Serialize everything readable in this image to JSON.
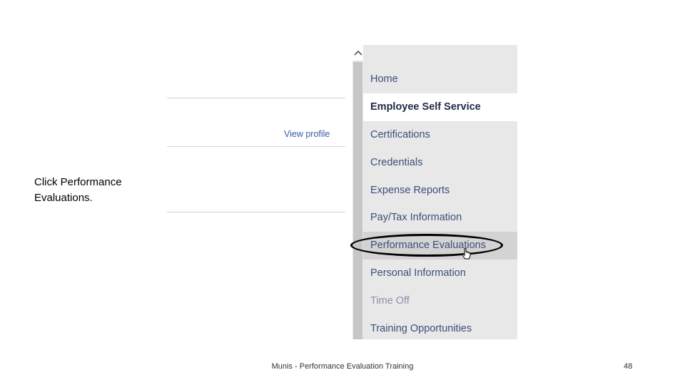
{
  "instruction": "Click Performance Evaluations.",
  "profile": {
    "view_profile_label": "View profile"
  },
  "nav": {
    "items": [
      {
        "label": "Home",
        "state": "normal"
      },
      {
        "label": "Employee Self Service",
        "state": "active"
      },
      {
        "label": "Certifications",
        "state": "normal"
      },
      {
        "label": "Credentials",
        "state": "normal"
      },
      {
        "label": "Expense Reports",
        "state": "normal"
      },
      {
        "label": "Pay/Tax Information",
        "state": "normal"
      },
      {
        "label": "Performance Evaluations",
        "state": "hover-highlighted"
      },
      {
        "label": "Personal Information",
        "state": "normal"
      },
      {
        "label": "Time Off",
        "state": "faded"
      },
      {
        "label": "Training Opportunities",
        "state": "normal"
      }
    ]
  },
  "footer": {
    "caption": "Munis - Performance Evaluation Training",
    "page_number": "48"
  },
  "colors": {
    "nav_background": "#e8e8e8",
    "nav_text": "#3c4f78",
    "link": "#3a5aa8",
    "highlight": "#d3d3d3"
  }
}
